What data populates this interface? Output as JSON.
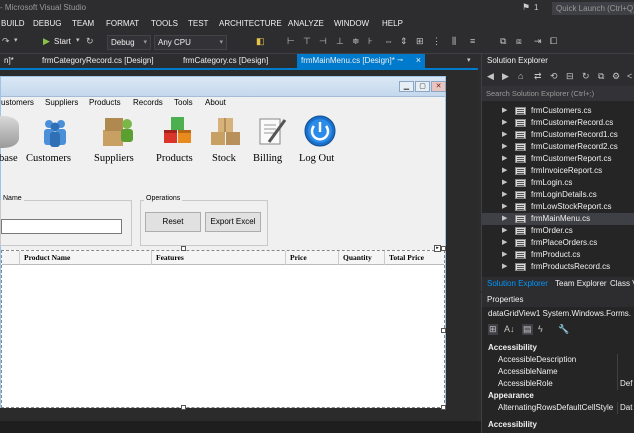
{
  "window": {
    "title": "- Microsoft Visual Studio",
    "notif_count": "1",
    "quick_launch": "Quick Launch (Ctrl+Q)"
  },
  "menu": [
    "BUILD",
    "DEBUG",
    "TEAM",
    "FORMAT",
    "TOOLS",
    "TEST",
    "ARCHITECTURE",
    "ANALYZE",
    "WINDOW",
    "HELP"
  ],
  "toolbar": {
    "start_label": "Start",
    "config": "Debug",
    "platform": "Any CPU"
  },
  "doc_tabs": [
    {
      "label": "n]*",
      "active": false
    },
    {
      "label": "frmCategoryRecord.cs [Design]",
      "active": false
    },
    {
      "label": "frmCategory.cs [Design]",
      "active": false
    },
    {
      "label": "frmMainMenu.cs [Design]*",
      "active": true
    }
  ],
  "form": {
    "menu": [
      "ustomers",
      "Suppliers",
      "Products",
      "Records",
      "Tools",
      "About"
    ],
    "tiles": [
      {
        "label": "base",
        "icon": "database-icon"
      },
      {
        "label": "Customers",
        "icon": "customers-icon"
      },
      {
        "label": "Suppliers",
        "icon": "suppliers-icon"
      },
      {
        "label": "Products",
        "icon": "products-icon"
      },
      {
        "label": "Stock",
        "icon": "stock-icon"
      },
      {
        "label": "Billing",
        "icon": "billing-icon"
      },
      {
        "label": "Log Out",
        "icon": "power-icon"
      }
    ],
    "name_group": "Name",
    "ops_group": "Operations",
    "reset_btn": "Reset",
    "export_btn": "Export Excel",
    "grid_columns": [
      "",
      "Product Name",
      "Features",
      "Price",
      "Quantity",
      "Total Price"
    ]
  },
  "solution_explorer": {
    "title": "Solution Explorer",
    "search": "Search Solution Explorer (Ctrl+;)",
    "items": [
      "frmCustomers.cs",
      "frmCustomerRecord.cs",
      "frmCustomerRecord1.cs",
      "frmCustomerRecord2.cs",
      "frmCustomerReport.cs",
      "frmInvoiceReport.cs",
      "frmLogin.cs",
      "frmLoginDetails.cs",
      "frmLowStockReport.cs",
      "frmMainMenu.cs",
      "frmOrder.cs",
      "frmPlaceOrders.cs",
      "frmProduct.cs",
      "frmProductsRecord.cs"
    ],
    "selected": "frmMainMenu.cs",
    "tabs": [
      "Solution Explorer",
      "Team Explorer",
      "Class Vi"
    ]
  },
  "properties": {
    "title": "Properties",
    "object": "dataGridView1  System.Windows.Forms.",
    "rows": [
      {
        "cat": "Accessibility"
      },
      {
        "name": "AccessibleDescription",
        "value": ""
      },
      {
        "name": "AccessibleName",
        "value": ""
      },
      {
        "name": "AccessibleRole",
        "value": "Def"
      },
      {
        "cat": "Appearance"
      },
      {
        "name": "AlternatingRowsDefaultCellStyle",
        "value": "Dat"
      }
    ],
    "footer": "Accessibility"
  }
}
